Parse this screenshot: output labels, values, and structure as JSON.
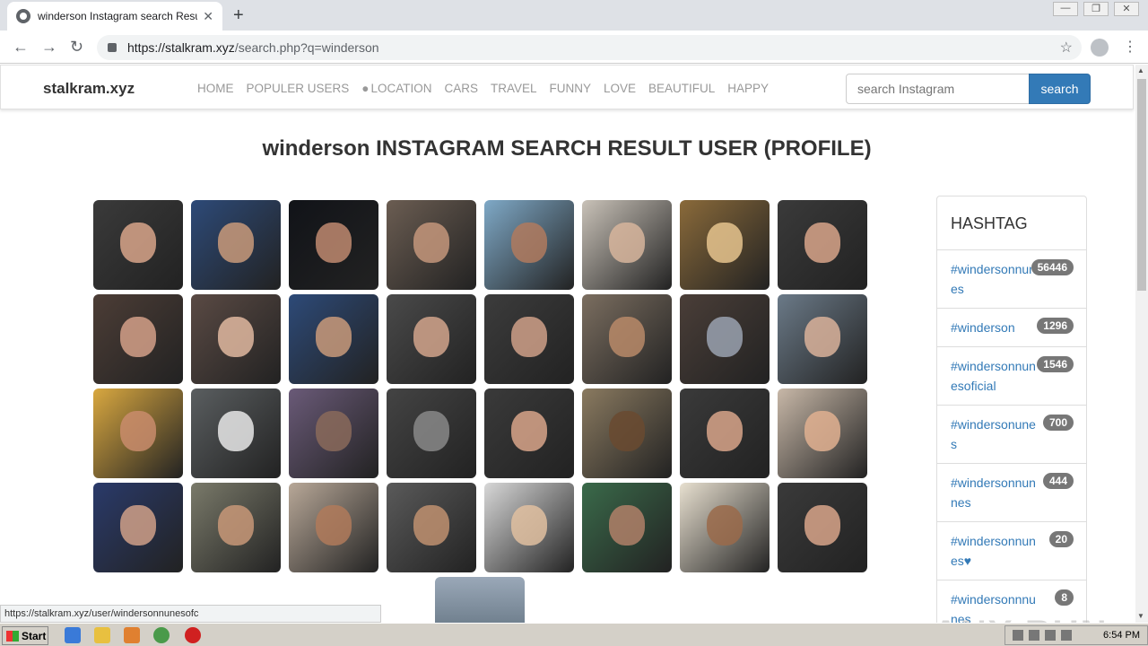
{
  "browser": {
    "tab_title": "winderson Instagram search Result",
    "tab_close": "✕",
    "newtab": "+",
    "url_host": "https://stalkram.xyz",
    "url_path": "/search.php?q=winderson",
    "status_url": "https://stalkram.xyz/user/windersonnunesofc",
    "back": "←",
    "forward": "→",
    "reload": "↻",
    "star": "☆",
    "menu": "⋮"
  },
  "site": {
    "brand": "stalkram.xyz",
    "nav": [
      "HOME",
      "POPULER USERS",
      "LOCATION",
      "CARS",
      "TRAVEL",
      "FUNNY",
      "LOVE",
      "BEAUTIFUL",
      "HAPPY"
    ],
    "search_placeholder": "search Instagram",
    "search_button": "search",
    "heading": "winderson INSTAGRAM SEARCH RESULT USER (PROFILE)"
  },
  "thumbnails": [
    {
      "bg": "#3a3a3a",
      "skin": "#d8a58a"
    },
    {
      "bg": "#2d4a78",
      "skin": "#c99a7a"
    },
    {
      "bg": "#111318",
      "skin": "#c08a70"
    },
    {
      "bg": "#6b5d52",
      "skin": "#c4967b"
    },
    {
      "bg": "#7fa9c7",
      "skin": "#b07a5e"
    },
    {
      "bg": "#c9c2b8",
      "skin": "#d7b59c"
    },
    {
      "bg": "#8a6a3a",
      "skin": "#e6c48e"
    },
    {
      "bg": "#3a3a3a",
      "skin": "#d8a58a"
    },
    {
      "bg": "#4c3d36",
      "skin": "#d4a088"
    },
    {
      "bg": "#5a4a44",
      "skin": "#e0b8a0"
    },
    {
      "bg": "#2d4a78",
      "skin": "#c99a7a"
    },
    {
      "bg": "#4a4a4a",
      "skin": "#d2a48c"
    },
    {
      "bg": "#3c3c3c",
      "skin": "#cfa088"
    },
    {
      "bg": "#7b6e60",
      "skin": "#b88a68"
    },
    {
      "bg": "#4a3e38",
      "skin": "#9aa2b0"
    },
    {
      "bg": "#6b7a88",
      "skin": "#d9b29a"
    },
    {
      "bg": "#d9a840",
      "skin": "#c98c6c"
    },
    {
      "bg": "#5a5e60",
      "skin": "#e8e8e8"
    },
    {
      "bg": "#6a5a78",
      "skin": "#8a6a5a"
    },
    {
      "bg": "#444444",
      "skin": "#888888"
    },
    {
      "bg": "#3a3a3a",
      "skin": "#d8a58a"
    },
    {
      "bg": "#8a7a60",
      "skin": "#6a4a30"
    },
    {
      "bg": "#3a3a3a",
      "skin": "#d8a58a"
    },
    {
      "bg": "#c8b8a8",
      "skin": "#e0b090"
    },
    {
      "bg": "#2a3a6a",
      "skin": "#d0a088"
    },
    {
      "bg": "#7a7a6a",
      "skin": "#c89878"
    },
    {
      "bg": "#b8a898",
      "skin": "#b07a5a"
    },
    {
      "bg": "#5a5a5a",
      "skin": "#c09070"
    },
    {
      "bg": "#d8d8d8",
      "skin": "#e0c0a0"
    },
    {
      "bg": "#3a6a4a",
      "skin": "#b08068"
    },
    {
      "bg": "#e8e0d0",
      "skin": "#9a6a4a"
    },
    {
      "bg": "#3a3a3a",
      "skin": "#d8a58a"
    }
  ],
  "hashtags": {
    "title": "HASHTAG",
    "items": [
      {
        "tag": "#windersonnunes",
        "count": "56446"
      },
      {
        "tag": "#winderson",
        "count": "1296"
      },
      {
        "tag": "#windersonnunesoficial",
        "count": "1546"
      },
      {
        "tag": "#windersonunes",
        "count": "700"
      },
      {
        "tag": "#windersonnunnes",
        "count": "444"
      },
      {
        "tag": "#windersonnunes♥",
        "count": "20"
      },
      {
        "tag": "#windersonnnunes",
        "count": "8"
      }
    ]
  },
  "taskbar": {
    "start": "Start",
    "clock": "6:54 PM"
  },
  "watermark": "ANY RUN"
}
